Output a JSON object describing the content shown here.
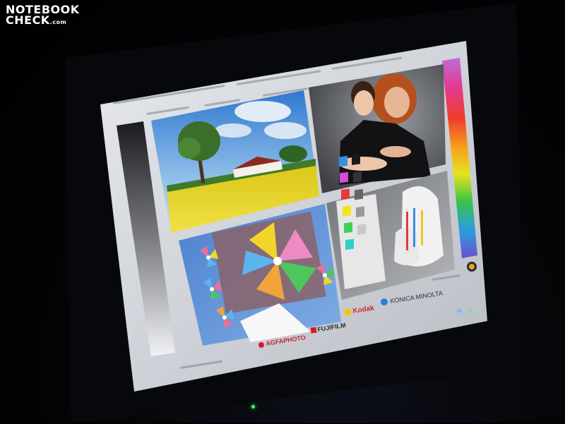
{
  "watermark": {
    "line1": "NOTEBOOK",
    "line2": "CHECK",
    "line2_suffix": ".com"
  },
  "brands": {
    "agfa": "AGFAPHOTO",
    "fujifilm": "FUJIFILM",
    "kodak": "Kodak",
    "konica": "KONICA MINOLTA"
  },
  "colors": {
    "screen_bg": "#d4d7dd",
    "sky": "#4b8fd8",
    "rapeseed": "#e6d21a",
    "portrait_bg": "#5e6166",
    "pinwheel_bg": "#5f8fd6",
    "still_life_bg": "#8d9096"
  }
}
